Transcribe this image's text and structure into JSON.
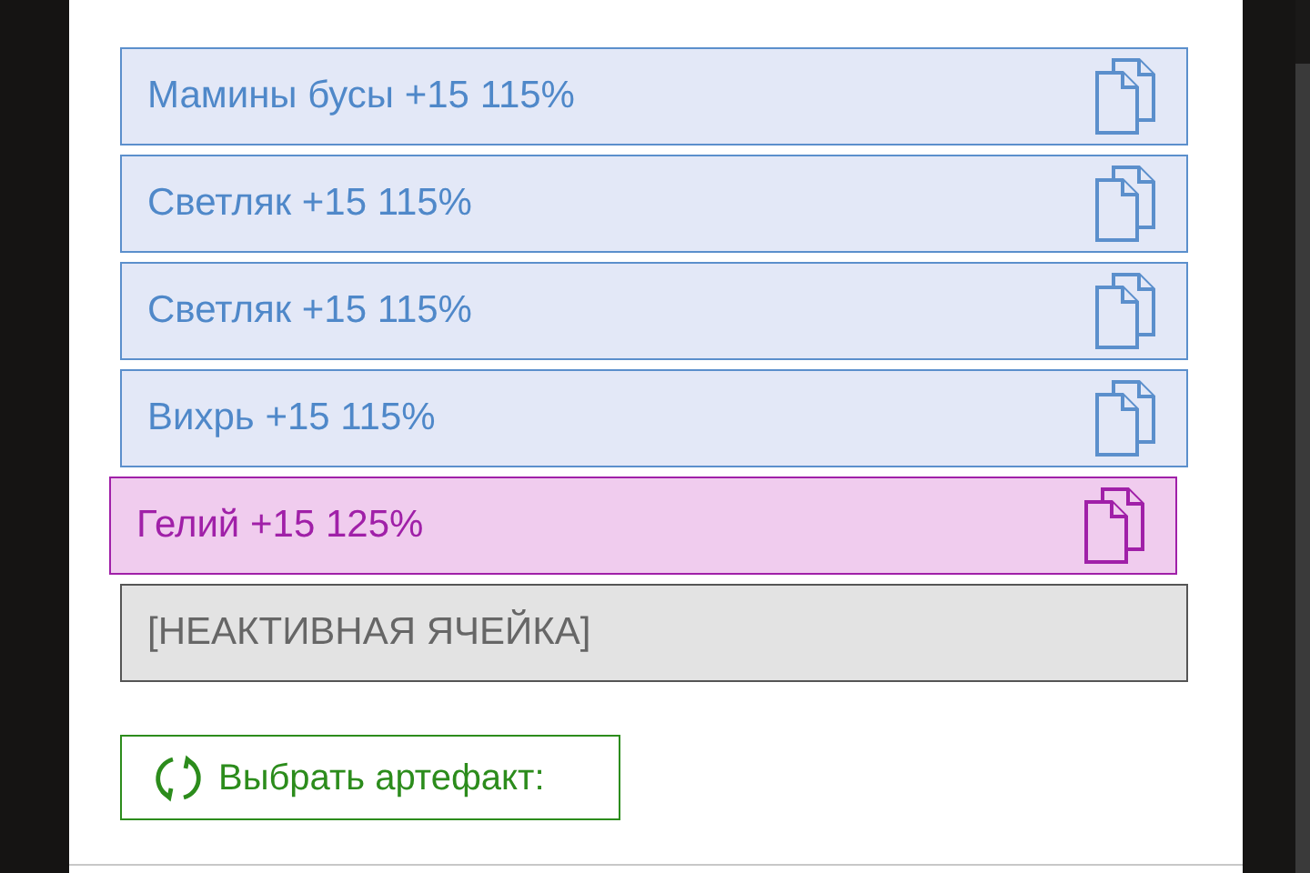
{
  "artifacts": [
    {
      "label": "Мамины бусы +15 115%",
      "selected": false
    },
    {
      "label": "Светляк +15 115%",
      "selected": false
    },
    {
      "label": "Светляк +15 115%",
      "selected": false
    },
    {
      "label": "Вихрь +15 115%",
      "selected": false
    },
    {
      "label": "Гелий +15 125%",
      "selected": true
    }
  ],
  "inactive_cell": {
    "label": "[НЕАКТИВНАЯ ЯЧЕЙКА]"
  },
  "choose_button": {
    "label": "Выбрать артефакт:"
  }
}
